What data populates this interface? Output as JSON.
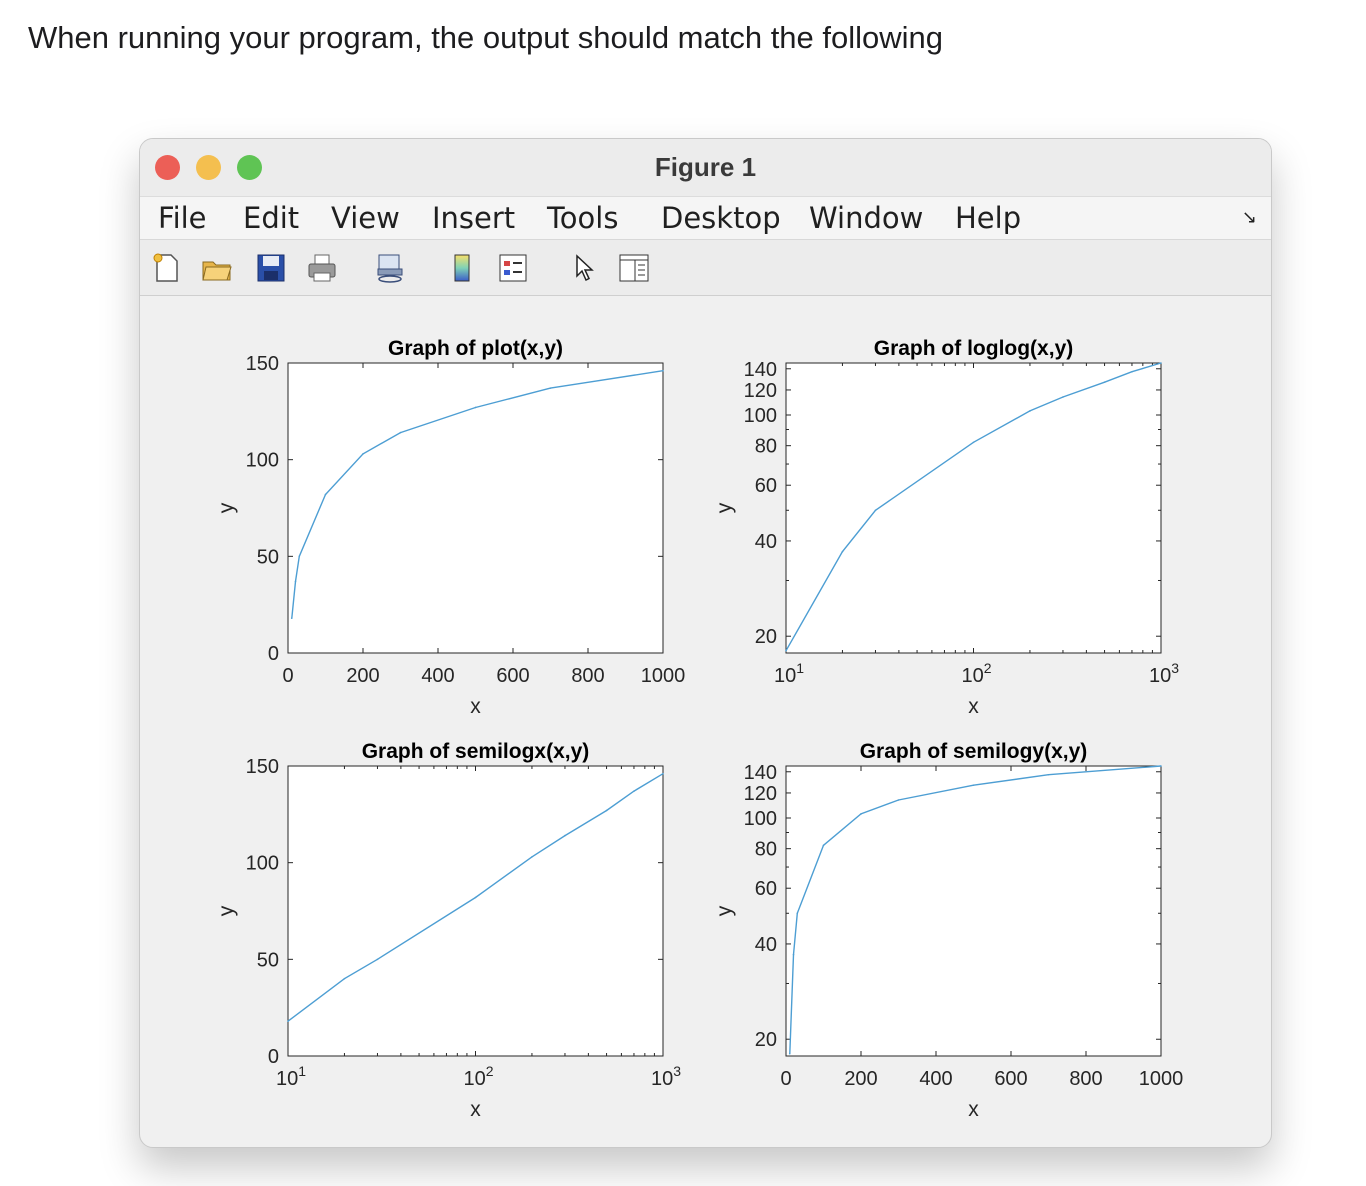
{
  "intro_text": "When running your program, the output should match the following",
  "window": {
    "title": "Figure 1",
    "traffic_lights": [
      "#ec5f57",
      "#f4bf4f",
      "#5fc454"
    ],
    "menu": [
      "File",
      "Edit",
      "View",
      "Insert",
      "Tools",
      "Desktop",
      "Window",
      "Help"
    ],
    "menu_arrow": "↘",
    "toolbar_icons": [
      "new-figure-icon",
      "open-file-icon",
      "save-icon",
      "print-icon",
      "link-icon",
      "colorbar-icon",
      "legend-icon",
      "pointer-icon",
      "property-editor-icon"
    ]
  },
  "chart_data": [
    {
      "type": "line",
      "title": "Graph of plot(x,y)",
      "xlabel": "x",
      "ylabel": "y",
      "xscale": "linear",
      "yscale": "linear",
      "xlim": [
        0,
        1000
      ],
      "ylim": [
        0,
        150
      ],
      "xticks": [
        0,
        200,
        400,
        600,
        800,
        1000
      ],
      "xticklabels": [
        "0",
        "200",
        "400",
        "600",
        "800",
        "1000"
      ],
      "yticks": [
        0,
        50,
        100,
        150
      ],
      "yticklabels": [
        "0",
        "50",
        "100",
        "150"
      ],
      "color": "#4d9ed3",
      "x": [
        10,
        20,
        30,
        100,
        200,
        300,
        500,
        700,
        1000
      ],
      "y": [
        18,
        37,
        50,
        82,
        103,
        114,
        127,
        137,
        146
      ]
    },
    {
      "type": "line",
      "title": "Graph of loglog(x,y)",
      "xlabel": "x",
      "ylabel": "y",
      "xscale": "log",
      "yscale": "log",
      "xlim": [
        10,
        1000
      ],
      "ylim": [
        17.7,
        146
      ],
      "xticks": [
        10,
        100,
        1000
      ],
      "xticklabels": [
        [
          "10",
          "1"
        ],
        [
          "10",
          "2"
        ],
        [
          "10",
          "3"
        ]
      ],
      "yticks": [
        20,
        40,
        60,
        80,
        100,
        120,
        140
      ],
      "yticklabels": [
        "20",
        "40",
        "60",
        "80",
        "100",
        "120",
        "140"
      ],
      "color": "#4d9ed3",
      "x": [
        10,
        20,
        30,
        100,
        200,
        300,
        500,
        700,
        1000
      ],
      "y": [
        18,
        37,
        50,
        82,
        103,
        114,
        127,
        137,
        146
      ]
    },
    {
      "type": "line",
      "title": "Graph of semilogx(x,y)",
      "xlabel": "x",
      "ylabel": "y",
      "xscale": "log",
      "yscale": "linear",
      "xlim": [
        10,
        1000
      ],
      "ylim": [
        0,
        150
      ],
      "xticks": [
        10,
        100,
        1000
      ],
      "xticklabels": [
        [
          "10",
          "1"
        ],
        [
          "10",
          "2"
        ],
        [
          "10",
          "3"
        ]
      ],
      "yticks": [
        0,
        50,
        100,
        150
      ],
      "yticklabels": [
        "0",
        "50",
        "100",
        "150"
      ],
      "color": "#4d9ed3",
      "x": [
        10,
        20,
        30,
        100,
        200,
        300,
        500,
        700,
        1000
      ],
      "y": [
        18,
        40,
        50,
        82,
        103,
        114,
        127,
        137,
        146
      ]
    },
    {
      "type": "line",
      "title": "Graph of semilogy(x,y)",
      "xlabel": "x",
      "ylabel": "y",
      "xscale": "linear",
      "yscale": "log",
      "xlim": [
        0,
        1000
      ],
      "ylim": [
        17.7,
        146
      ],
      "xticks": [
        0,
        200,
        400,
        600,
        800,
        1000
      ],
      "xticklabels": [
        "0",
        "200",
        "400",
        "600",
        "800",
        "1000"
      ],
      "yticks": [
        20,
        40,
        60,
        80,
        100,
        120,
        140
      ],
      "yticklabels": [
        "20",
        "40",
        "60",
        "80",
        "100",
        "120",
        "140"
      ],
      "color": "#4d9ed3",
      "x": [
        10,
        20,
        30,
        100,
        200,
        300,
        500,
        700,
        1000
      ],
      "y": [
        18,
        37,
        50,
        82,
        103,
        114,
        127,
        137,
        146
      ]
    }
  ]
}
